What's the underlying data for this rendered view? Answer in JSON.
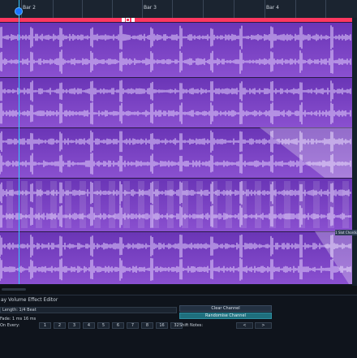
{
  "ruler": {
    "bars": [
      "Bar 2",
      "Bar 3",
      "Bar 4"
    ]
  },
  "loop_bar": {
    "color": "#ff375f"
  },
  "playhead": {
    "color": "#34c9ff"
  },
  "tracks_panel": {
    "accent": "#8a50d0"
  },
  "side_tag": "1 Slot Chords",
  "panel": {
    "title": "ay Volume Effect Editor",
    "length_label": "Length: 1/4 Beat",
    "fade_label": "Fade: 1 ms 16 ms",
    "on_every_label": "On Every:",
    "on_every_options": [
      "1",
      "2",
      "3",
      "4",
      "5",
      "6",
      "7",
      "8",
      "16",
      "32"
    ],
    "clear_label": "Clear Channel",
    "randomise_label": "Randomise Channel",
    "shift_label": "Shift Notes:",
    "shift_left": "<",
    "shift_right": ">"
  }
}
